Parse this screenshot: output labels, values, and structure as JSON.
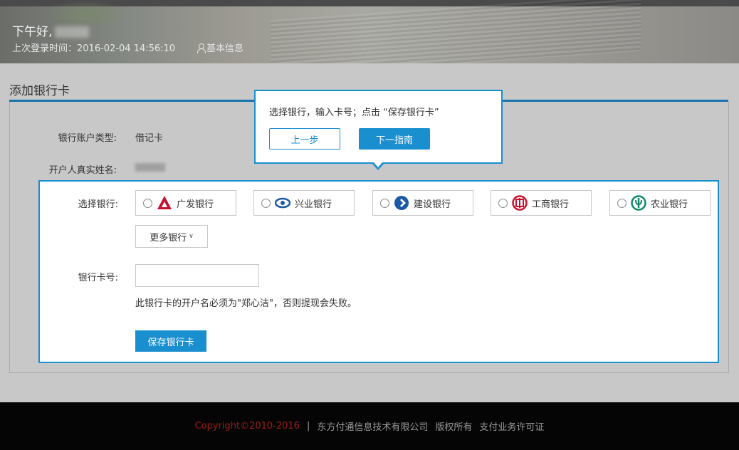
{
  "header": {
    "greeting": "下午好,",
    "last_login_label": "上次登录时间：",
    "last_login_time": "2016-02-04 14:56:10",
    "basic_info_label": "基本信息"
  },
  "section": {
    "title": "添加银行卡"
  },
  "form": {
    "account_type_label": "银行账户类型:",
    "account_type_value": "借记卡",
    "real_name_label": "开户人真实姓名:",
    "select_bank_label": "选择银行:",
    "banks": [
      {
        "name": "广发银行",
        "logo": "cgb-logo",
        "color": "#c8102e"
      },
      {
        "name": "兴业银行",
        "logo": "cib-logo",
        "color": "#1a5aa8"
      },
      {
        "name": "建设银行",
        "logo": "ccb-logo",
        "color": "#1a5aa8"
      },
      {
        "name": "工商银行",
        "logo": "icbc-logo",
        "color": "#c8102e"
      },
      {
        "name": "农业银行",
        "logo": "abc-logo",
        "color": "#0f8a6b"
      }
    ],
    "more_banks_label": "更多银行",
    "card_number_label": "银行卡号:",
    "card_number_value": "",
    "hint_text": "此银行卡的开户名必须为\"郑心洁\"，否则提现会失败。",
    "save_button": "保存银行卡"
  },
  "tooltip": {
    "text": "选择银行，输入卡号；点击 “保存银行卡”",
    "prev_button": "上一步",
    "next_button": "下一指南"
  },
  "footer": {
    "copyright": "Copyright©2010-2016",
    "separator": "|",
    "company": "东方付通信息技术有限公司",
    "rights": "版权所有",
    "license": "支付业务许可证"
  },
  "colors": {
    "accent": "#1a8fd0",
    "rule": "#1a74b0",
    "copyright_red": "#a01a1a"
  }
}
